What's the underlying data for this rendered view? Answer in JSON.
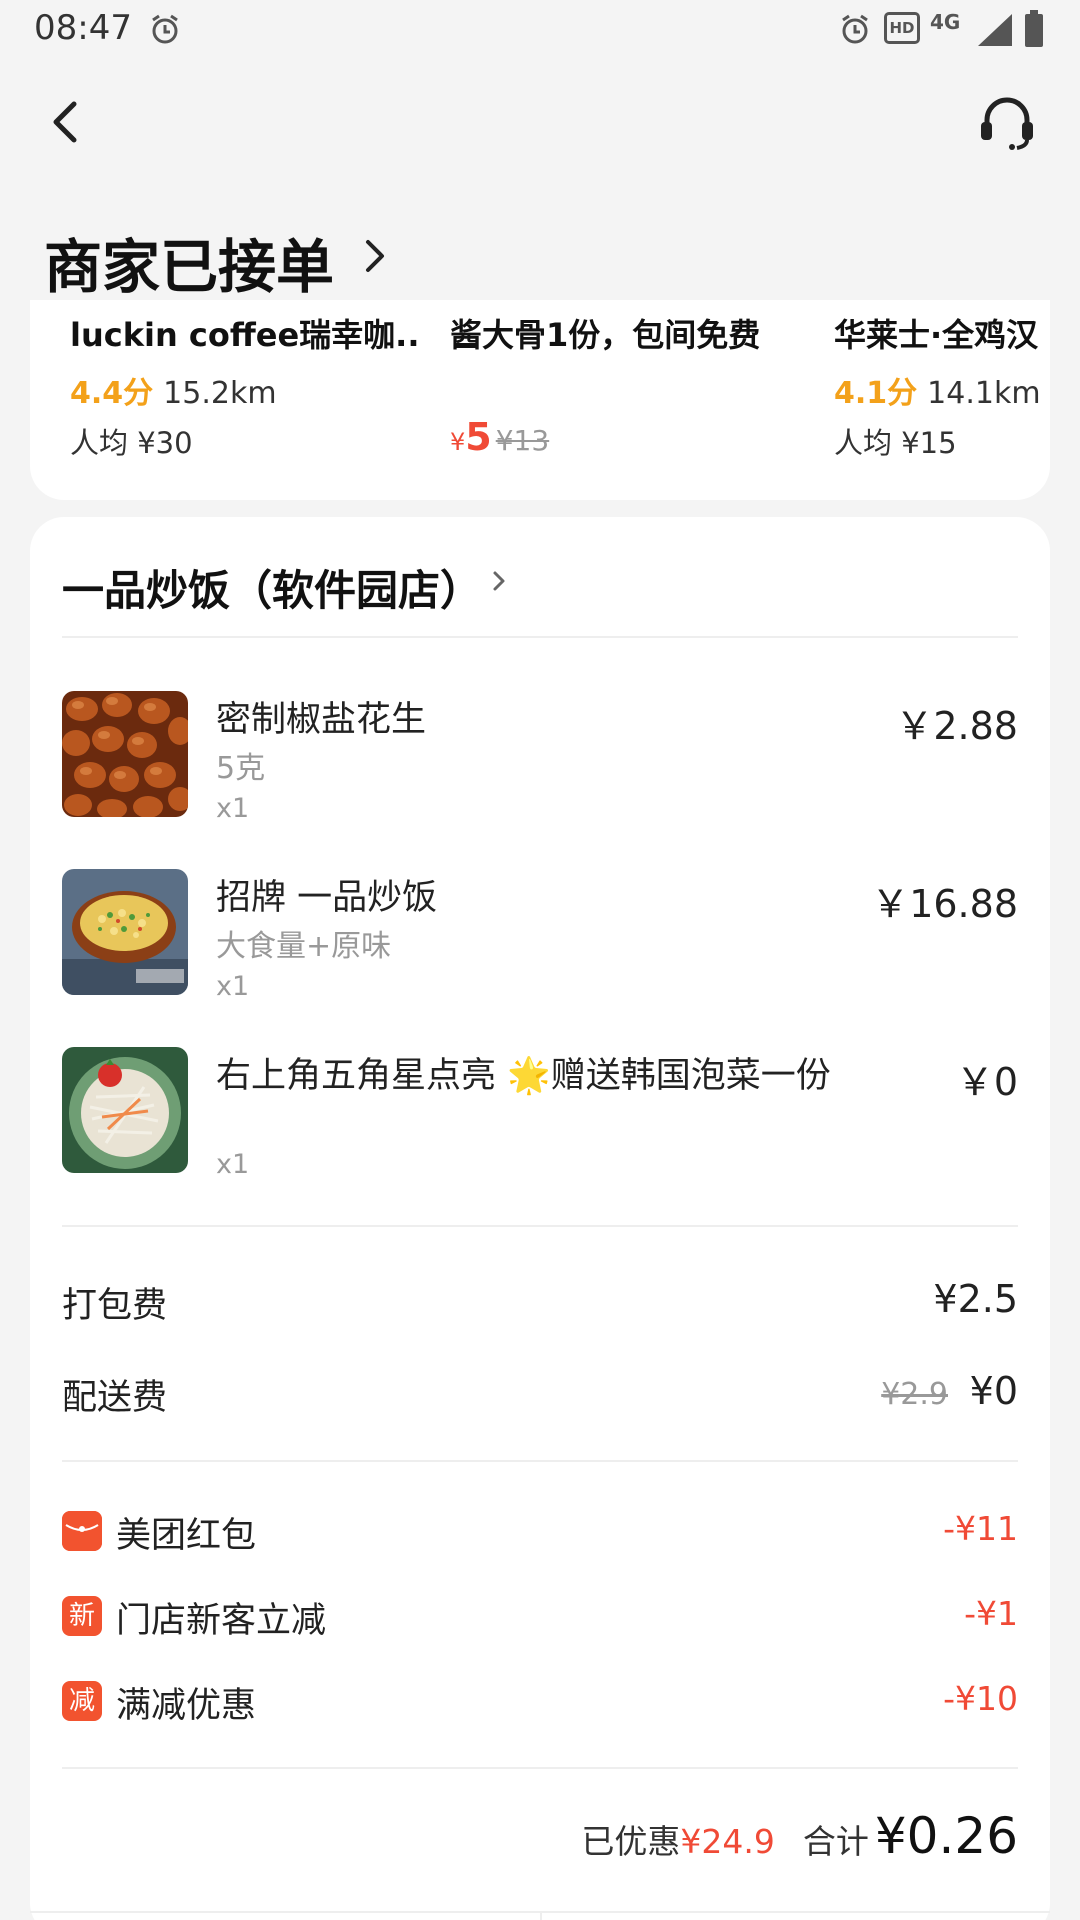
{
  "status_bar": {
    "time": "08:47",
    "icons": [
      "alarm-icon",
      "hd-icon",
      "4g-icon",
      "signal-icon",
      "battery-icon"
    ],
    "hd_text": "HD",
    "network_text": "4G"
  },
  "header": {
    "title": "商家已接单",
    "back_icon": "back-icon",
    "support_icon": "headset-icon"
  },
  "recommendations": [
    {
      "name": "luckin coffee瑞幸咖...",
      "rating": "4.4分",
      "distance": "15.2km",
      "avg": "人均 ¥30"
    },
    {
      "name": "酱大骨1份，包间免费",
      "price_symbol": "¥",
      "price": "5",
      "orig_price": "¥13"
    },
    {
      "name": "华莱士·全鸡汉",
      "rating": "4.1分",
      "distance": "14.1km",
      "avg": "人均 ¥15"
    }
  ],
  "order": {
    "shop_name": "一品炒饭（软件园店）",
    "items": [
      {
        "name": "密制椒盐花生",
        "spec": "5克",
        "qty": "x1",
        "price": "￥2.88"
      },
      {
        "name": "招牌 一品炒饭",
        "spec": "大食量+原味",
        "qty": "x1",
        "price": "￥16.88"
      },
      {
        "name": "右上角五角星点亮 🌟赠送韩国泡菜一份",
        "spec": "",
        "qty": "x1",
        "price": "￥0"
      }
    ],
    "fees": {
      "packing_label": "打包费",
      "packing_value": "¥2.5",
      "delivery_label": "配送费",
      "delivery_orig": "¥2.9",
      "delivery_value": "¥0"
    },
    "discounts": [
      {
        "badge": "",
        "label": "美团红包",
        "value": "-¥11"
      },
      {
        "badge": "新",
        "label": "门店新客立减",
        "value": "-¥1"
      },
      {
        "badge": "减",
        "label": "满减优惠",
        "value": "-¥10"
      }
    ],
    "summary": {
      "saved_label": "已优惠",
      "saved_value": "¥24.9",
      "total_label": "合计",
      "total_value": "¥0.26"
    }
  },
  "colors": {
    "accent_red": "#f04a36",
    "rating_orange": "#f3a11a",
    "badge_red": "#f2532f"
  }
}
